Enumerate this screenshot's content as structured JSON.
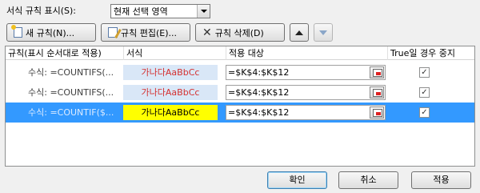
{
  "show_rules": {
    "label": "서식 규칙 표시(S):",
    "value": "현재 선택 영역"
  },
  "toolbar": {
    "new_rule": "새 규칙(N)...",
    "edit_rule": "규칙 편집(E)...",
    "delete_rule": "규칙 삭제(D)"
  },
  "grid": {
    "headers": {
      "rule": "규칙(표시 순서대로 적용)",
      "format": "서식",
      "applies_to": "적용 대상",
      "stop_if_true": "True일 경우 중지"
    },
    "rows": [
      {
        "condition": "수식: =COUNTIFS(...",
        "preview": "가나다AaBbCc",
        "applies_to": "=$K$4:$K$12",
        "stop": "✓"
      },
      {
        "condition": "수식: =COUNTIFS(...",
        "preview": "가나다AaBbCc",
        "applies_to": "=$K$4:$K$12",
        "stop": "✓"
      },
      {
        "condition": "수식: =COUNTIF($...",
        "preview": "가나다AaBbCc",
        "applies_to": "=$K$4:$K$12",
        "stop": "✓"
      }
    ]
  },
  "footer": {
    "ok": "확인",
    "cancel": "취소",
    "apply": "적용"
  },
  "colors": {
    "selection": "#3399ff",
    "preview_text": "#d43030",
    "preview_bg": "#d9e7f7",
    "highlight_fill": "#ffff00"
  }
}
